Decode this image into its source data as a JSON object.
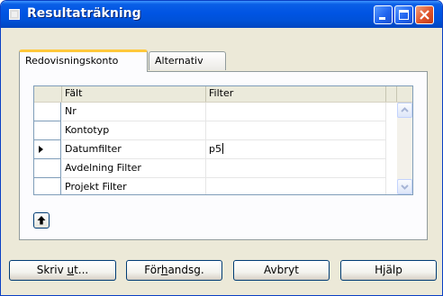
{
  "window": {
    "title": "Resultaträkning"
  },
  "tabs": [
    {
      "label": "Redovisningskonto",
      "active": true
    },
    {
      "label": "Alternativ",
      "active": false
    }
  ],
  "grid": {
    "columns": [
      "Fält",
      "Filter"
    ],
    "rows": [
      {
        "field": "Nr",
        "filter": "",
        "current": false
      },
      {
        "field": "Kontotyp",
        "filter": "",
        "current": false
      },
      {
        "field": "Datumfilter",
        "filter": "p5",
        "current": true
      },
      {
        "field": "Avdelning Filter",
        "filter": "",
        "current": false
      },
      {
        "field": "Projekt Filter",
        "filter": "",
        "current": false
      }
    ]
  },
  "buttons": {
    "print": {
      "pre": "Skriv ",
      "accel": "u",
      "post": "t..."
    },
    "preview": {
      "pre": "För",
      "accel": "h",
      "post": "andsg."
    },
    "cancel": "Avbryt",
    "help": "Hjälp"
  },
  "colors": {
    "titlebar": "#0054e3",
    "tab_active_accent": "#ffc83c",
    "dialog_bg": "#ece9d8"
  },
  "icons": [
    "app-icon",
    "minimize-icon",
    "maximize-icon",
    "close-icon",
    "row-pointer-icon",
    "scroll-up-icon",
    "scroll-down-icon",
    "arrow-up-icon"
  ]
}
